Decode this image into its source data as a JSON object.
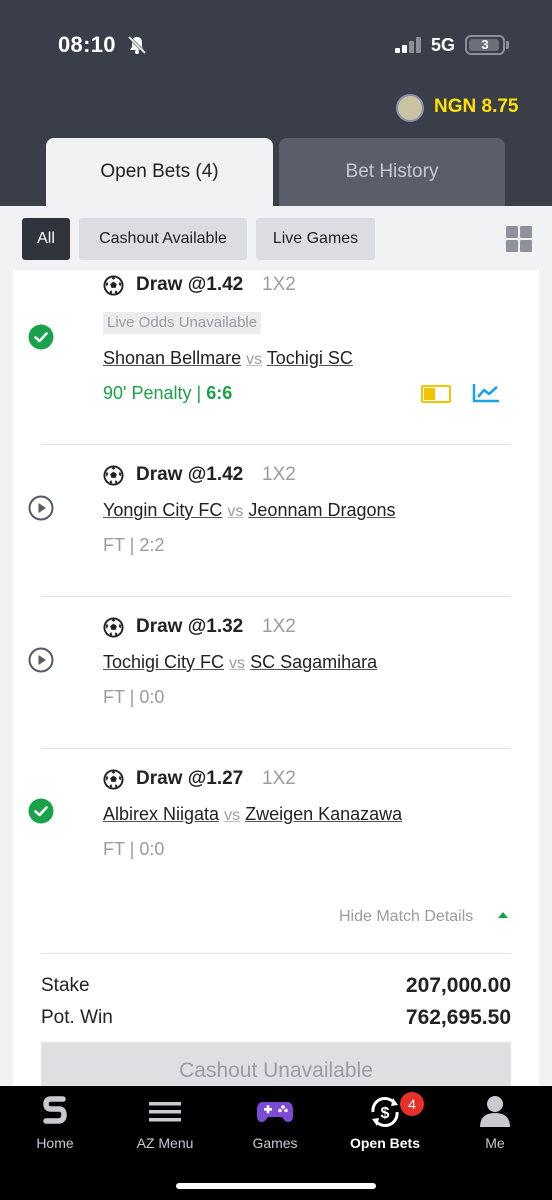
{
  "status_bar": {
    "time": "08:10",
    "network": "5G",
    "battery": "3"
  },
  "header": {
    "balance": "NGN 8.75"
  },
  "tabs": [
    {
      "label": "Open Bets (4)"
    },
    {
      "label": "Bet History"
    }
  ],
  "filters": [
    {
      "label": "All"
    },
    {
      "label": "Cashout Available"
    },
    {
      "label": "Live Games"
    }
  ],
  "bets": [
    {
      "pick": "Draw @1.42",
      "market": "1X2",
      "notice": "Live Odds Unavailable",
      "home": "Shonan Bellmare",
      "vs": "vs",
      "away": "Tochigi SC",
      "minute": "90' Penalty |",
      "score": "6:6",
      "status": "won"
    },
    {
      "pick": "Draw @1.42",
      "market": "1X2",
      "home": "Yongin City FC",
      "vs": "vs",
      "away": "Jeonnam Dragons",
      "result": "FT | 2:2",
      "status": "finished"
    },
    {
      "pick": "Draw @1.32",
      "market": "1X2",
      "home": "Tochigi City FC",
      "vs": "vs",
      "away": "SC Sagamihara",
      "result": "FT | 0:0",
      "status": "finished"
    },
    {
      "pick": "Draw @1.27",
      "market": "1X2",
      "home": "Albirex Niigata",
      "vs": "vs",
      "away": "Zweigen Kanazawa",
      "result": "FT | 0:0",
      "status": "won"
    }
  ],
  "summary": {
    "hide_details": "Hide Match Details",
    "stake_label": "Stake",
    "stake": "207,000.00",
    "win_label": "Pot. Win",
    "win": "762,695.50",
    "cashout": "Cashout Unavailable"
  },
  "nav": {
    "items": [
      {
        "label": "Home",
        "icon": "sporty-logo-icon"
      },
      {
        "label": "AZ Menu",
        "icon": "menu-icon"
      },
      {
        "label": "Games",
        "icon": "gamepad-icon"
      },
      {
        "label": "Open Bets",
        "icon": "open-bets-icon"
      },
      {
        "label": "Me",
        "icon": "user-icon"
      }
    ],
    "open_bets_badge": "4"
  },
  "colors": {
    "header_bg": "#3a3e48",
    "accent_green": "#1aa24a",
    "balance_yellow": "#ffe000",
    "badge_red": "#e8302a",
    "stats_blue": "#1ba3e8"
  }
}
